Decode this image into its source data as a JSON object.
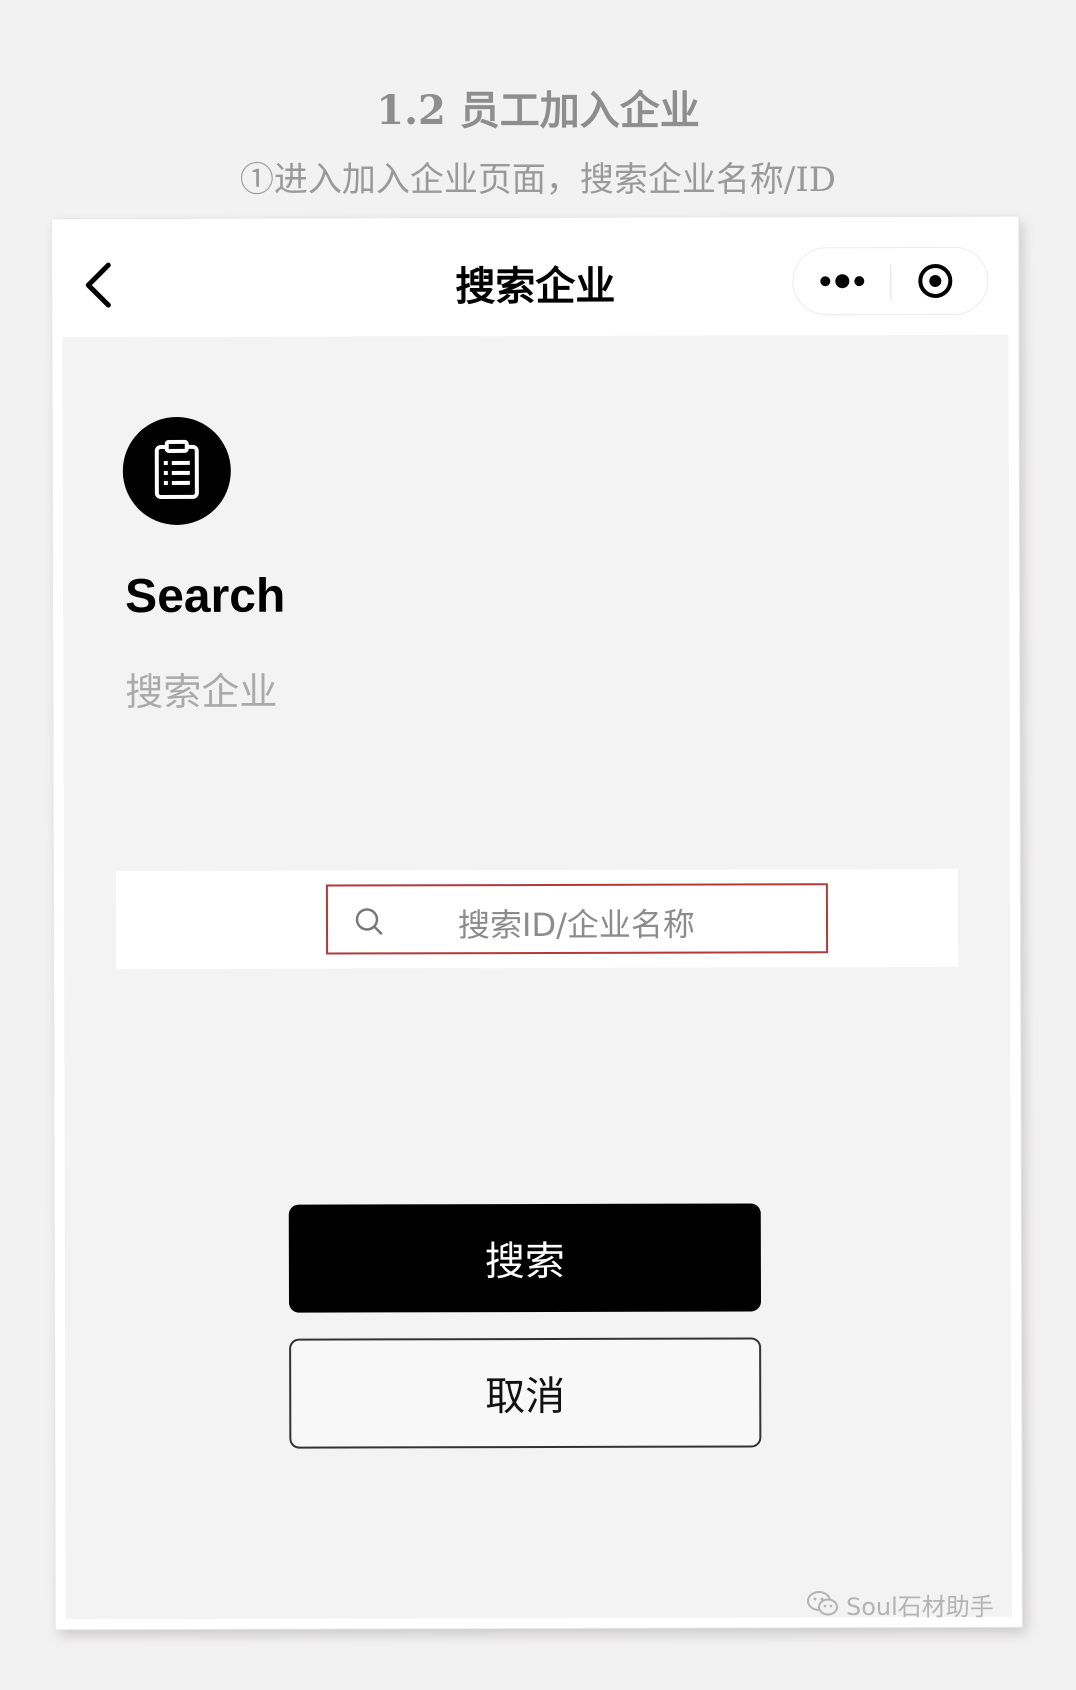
{
  "document": {
    "title": "1.2 员工加入企业",
    "subtitle": "①进入加入企业页面，搜索企业名称/ID"
  },
  "nav": {
    "title": "搜索企业",
    "back_icon": "chevron-left-icon",
    "more_icon": "more-dots-icon",
    "close_icon": "target-circle-icon"
  },
  "header": {
    "icon": "clipboard-list-icon",
    "title": "Search",
    "subtitle": "搜索企业"
  },
  "search": {
    "placeholder": "搜索ID/企业名称",
    "value": "",
    "highlight_color": "#b13a3a"
  },
  "actions": {
    "search_label": "搜索",
    "cancel_label": "取消"
  },
  "watermark": {
    "text": "Soul石材助手"
  },
  "colors": {
    "primary": "#000000",
    "background": "#f4f3f3"
  }
}
